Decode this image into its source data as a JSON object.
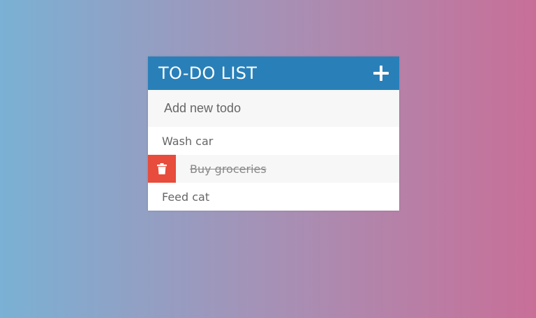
{
  "header": {
    "title": "TO-DO LIST",
    "add_icon": "plus-icon"
  },
  "input": {
    "placeholder": "Add new todo"
  },
  "todos": [
    {
      "text": "Wash car",
      "completed": false
    },
    {
      "text": "Buy groceries",
      "completed": true,
      "delete_icon": "trash-icon"
    },
    {
      "text": "Feed cat",
      "completed": false
    }
  ],
  "colors": {
    "header_bg": "#2980b9",
    "delete_bg": "#e74c3c",
    "gradient_left": "#7ab1d4",
    "gradient_right": "#c86f98"
  }
}
